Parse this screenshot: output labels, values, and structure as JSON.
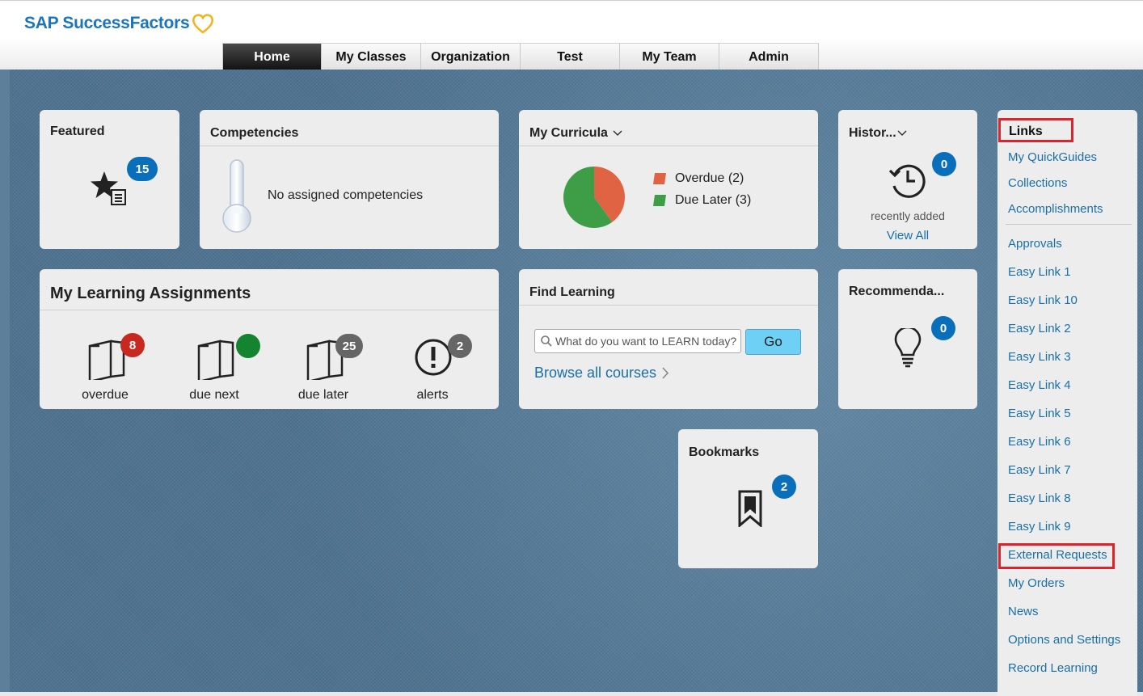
{
  "header": {
    "logo_text": "SAP SuccessFactors",
    "tabs": [
      "Home",
      "My Classes",
      "Organization",
      "Test",
      "My Team",
      "Admin"
    ],
    "active_tab": "Home"
  },
  "featured": {
    "title": "Featured",
    "badge": "15"
  },
  "competencies": {
    "title": "Competencies",
    "message": "No assigned competencies"
  },
  "curricula": {
    "title": "My Curricula",
    "legend": [
      {
        "label": "Overdue (2)",
        "color": "#e06444"
      },
      {
        "label": "Due Later (3)",
        "color": "#3e9e47"
      }
    ]
  },
  "history": {
    "title": "Histor...",
    "badge": "0",
    "caption": "recently added",
    "view_all": "View All"
  },
  "assignments": {
    "title": "My Learning Assignments",
    "items": [
      {
        "label": "overdue",
        "badge": "8"
      },
      {
        "label": "due next",
        "badge": ""
      },
      {
        "label": "due later",
        "badge": "25"
      },
      {
        "label": "alerts",
        "badge": "2"
      }
    ]
  },
  "find_learning": {
    "title": "Find Learning",
    "placeholder": "What do you want to LEARN today?",
    "go_label": "Go",
    "browse_label": "Browse all courses"
  },
  "recommendations": {
    "title": "Recommenda...",
    "badge": "0"
  },
  "bookmarks": {
    "title": "Bookmarks",
    "badge": "2"
  },
  "links": {
    "title": "Links",
    "items_top": [
      "My QuickGuides",
      "Collections",
      "Accomplishments"
    ],
    "items": [
      "Approvals",
      "Easy Link 1",
      "Easy Link 10",
      "Easy Link 2",
      "Easy Link 3",
      "Easy Link 4",
      "Easy Link 5",
      "Easy Link 6",
      "Easy Link 7",
      "Easy Link 8",
      "Easy Link 9",
      "External Requests",
      "My Orders",
      "News",
      "Options and Settings",
      "Record Learning"
    ]
  },
  "chart_data": {
    "type": "pie",
    "categories": [
      "Overdue",
      "Due Later"
    ],
    "values": [
      2,
      3
    ],
    "colors": [
      "#e06444",
      "#3e9e47"
    ]
  }
}
